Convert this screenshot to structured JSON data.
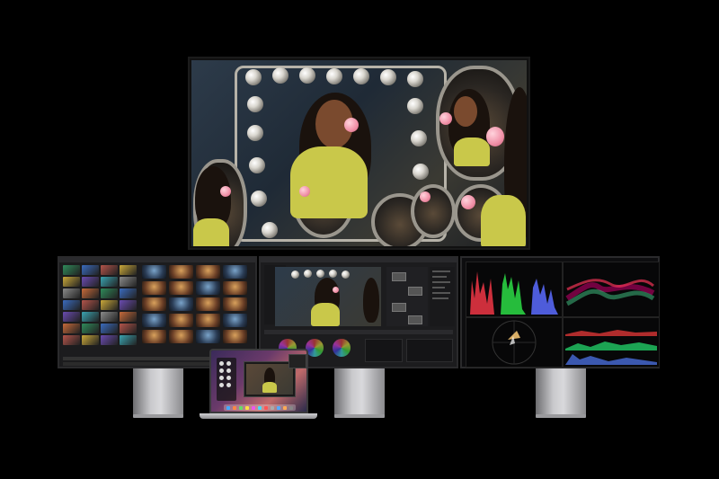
{
  "scene": {
    "description_visible_text": "",
    "background": "#000000"
  },
  "displays": {
    "reference": {
      "role": "reference-monitor"
    },
    "left": {
      "role": "media-pool"
    },
    "center": {
      "role": "color-page"
    },
    "right": {
      "role": "video-scopes"
    },
    "laptop": {
      "role": "macbook"
    }
  },
  "colors": {
    "shirt": "#c9c84a",
    "gum": "#f08fa6",
    "parade_red": "#ff3a4a",
    "parade_green": "#2eea4a",
    "parade_blue": "#5a6bff"
  }
}
